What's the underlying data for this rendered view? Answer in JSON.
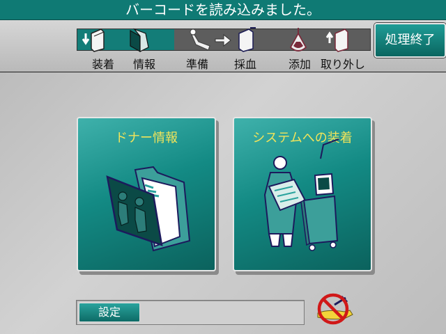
{
  "header": {
    "message": "バーコードを読み込みました。"
  },
  "progress": {
    "completed_fraction": 0.33,
    "steps": [
      {
        "label": "装着"
      },
      {
        "label": "情報"
      },
      {
        "label": "準備"
      },
      {
        "label": "採血"
      },
      {
        "label": "添加"
      },
      {
        "label": "取り外し"
      }
    ]
  },
  "toolbar": {
    "finish_label": "処理終了"
  },
  "main": {
    "donor_button_label": "ドナー情報",
    "system_button_label": "システムへの装着"
  },
  "footer": {
    "settings_label": "設定"
  },
  "colors": {
    "accent": "#137d78",
    "button_text": "#f1e45a",
    "no_symbol": "#d01818"
  }
}
